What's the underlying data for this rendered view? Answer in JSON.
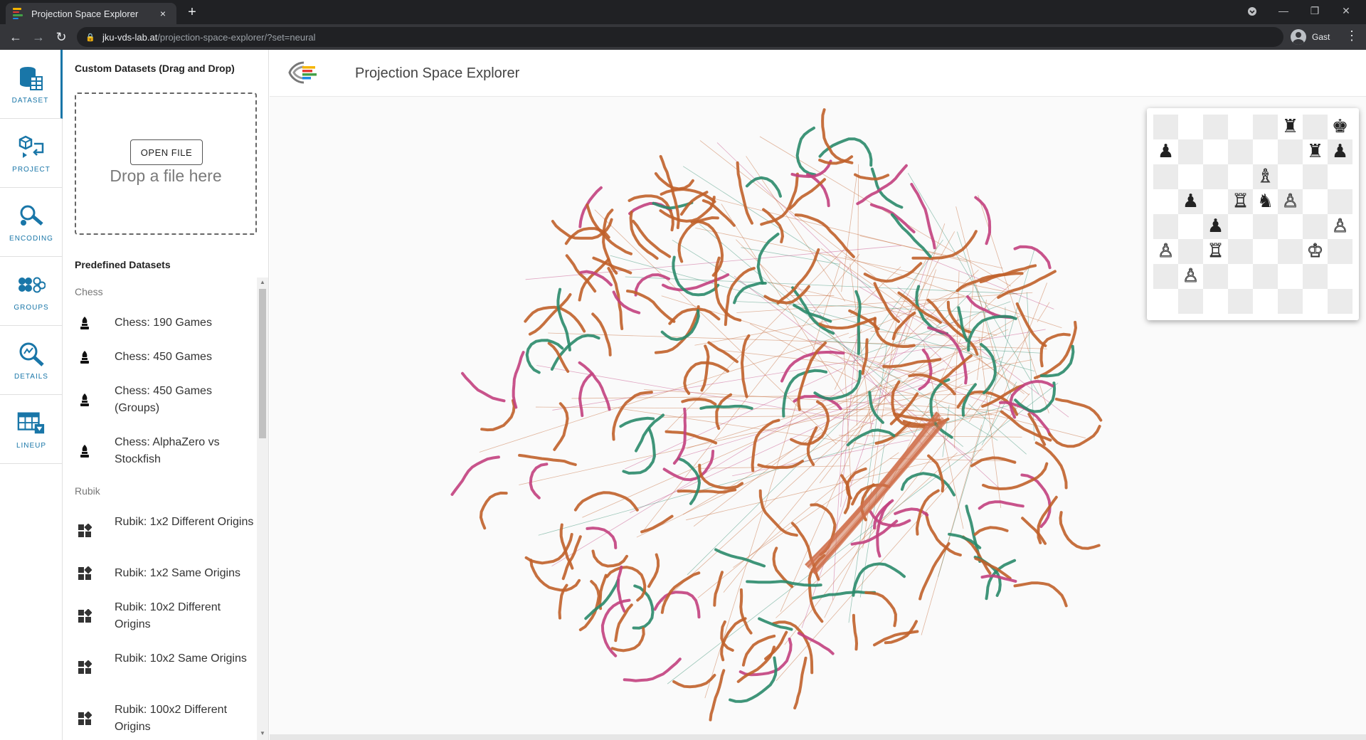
{
  "browser": {
    "tab_title": "Projection Space Explorer",
    "tab_close": "×",
    "new_tab": "+",
    "url_host": "jku-vds-lab.at",
    "url_path": "/projection-space-explorer/?set=neural",
    "profile_name": "Gast",
    "favicon_colors": [
      "#f5b400",
      "#e53935",
      "#43a047",
      "#1e88e5"
    ]
  },
  "rail": {
    "items": [
      {
        "label": "DATASET",
        "icon": "database-icon"
      },
      {
        "label": "PROJECT",
        "icon": "project-icon"
      },
      {
        "label": "ENCODING",
        "icon": "encoding-icon"
      },
      {
        "label": "GROUPS",
        "icon": "groups-icon"
      },
      {
        "label": "DETAILS",
        "icon": "details-icon"
      },
      {
        "label": "LINEUP",
        "icon": "lineup-icon"
      }
    ],
    "accent": "#1976a8"
  },
  "sidepanel": {
    "title": "Custom Datasets (Drag and Drop)",
    "open_file": "OPEN FILE",
    "drop_text": "Drop a file here",
    "predefined_title": "Predefined Datasets",
    "categories": [
      {
        "name": "Chess",
        "items": [
          "Chess: 190 Games",
          "Chess: 450 Games",
          "Chess: 450 Games (Groups)",
          "Chess: AlphaZero vs Stockfish"
        ]
      },
      {
        "name": "Rubik",
        "items": [
          "Rubik: 1x2 Different Origins",
          "Rubik: 1x2 Same Origins",
          "Rubik: 10x2 Different Origins",
          "Rubik: 10x2 Same Origins",
          "Rubik: 100x2 Different Origins"
        ]
      }
    ]
  },
  "main": {
    "app_title": "Projection Space Explorer"
  },
  "plot_colors": {
    "orange": "#c0602a",
    "pink": "#c2407e",
    "green": "#2a8a6a"
  },
  "chessboard": [
    [
      "",
      "",
      "",
      "",
      "",
      "♜",
      "",
      "♚"
    ],
    [
      "♟",
      "",
      "",
      "",
      "",
      "",
      "♜",
      "♟"
    ],
    [
      "",
      "",
      "",
      "",
      "♗",
      "",
      "",
      ""
    ],
    [
      "",
      "♟",
      "",
      "♖",
      "♞",
      "♙",
      "",
      ""
    ],
    [
      "",
      "",
      "♟",
      "",
      "",
      "",
      "",
      "♙"
    ],
    [
      "♙",
      "",
      "♖",
      "",
      "",
      "",
      "♔",
      ""
    ],
    [
      "",
      "♙",
      "",
      "",
      "",
      "",
      "",
      ""
    ],
    [
      "",
      "",
      "",
      "",
      "",
      "",
      "",
      ""
    ]
  ]
}
